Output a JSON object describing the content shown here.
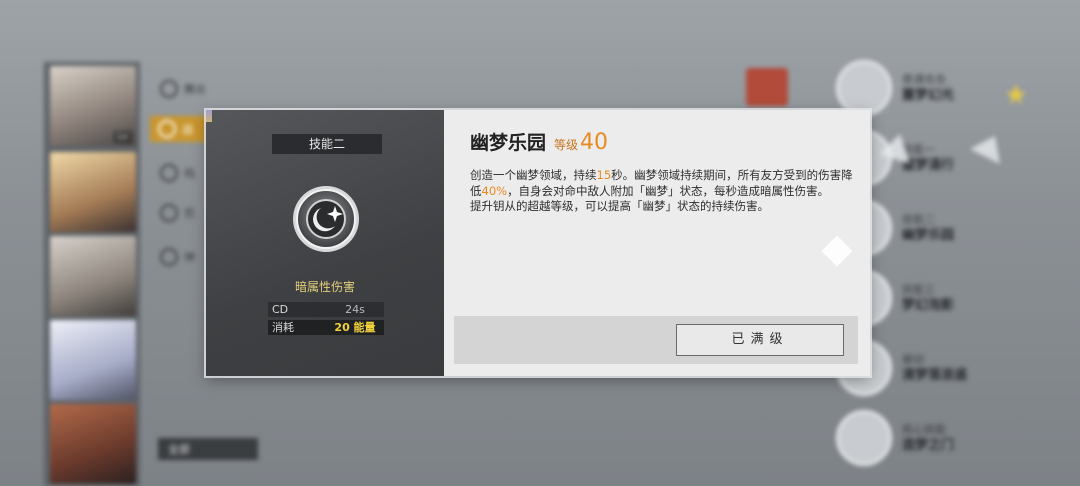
{
  "background": {
    "menu_items": [
      "舞台",
      "战",
      "档",
      "剪",
      "神"
    ],
    "all_button": "全部",
    "top_skill": {
      "sub": "普通攻击",
      "name": "噩梦幻光"
    },
    "skills": [
      {
        "sub": "技能一",
        "name": "噩梦涌行"
      },
      {
        "sub": "技能二",
        "name": "幽梦乐园"
      },
      {
        "sub": "技能三",
        "name": "梦幻泡影"
      },
      {
        "sub": "被动",
        "name": "清梦落浪遥"
      },
      {
        "sub": "核心技能",
        "name": "造梦之门"
      }
    ]
  },
  "skill": {
    "slot": "技能二",
    "icon": "moon-crescent-icon",
    "element": "暗属性伤害",
    "cd_label": "CD",
    "cd_value": "24s",
    "cost_label": "消耗",
    "cost_value": "20 能量",
    "name": "幽梦乐园",
    "level_label": "等级",
    "level_value": "40",
    "desc_p1": "创造一个幽梦领域，持续",
    "desc_dur": "15",
    "desc_p2": "秒。幽梦领域持续期间，所有友方受到的伤害降低",
    "desc_pct": "40%",
    "desc_p3": "，自身会对命中敌人附加「幽梦」状态，每秒造成暗属性伤害。",
    "desc_p4": "提升钥从的超越等级，可以提高「幽梦」状态的持续伤害。",
    "max_button": "已满级"
  },
  "colors": {
    "accent": "#e8891f",
    "energy": "#f2d23a",
    "element": "#e3cf7a"
  }
}
